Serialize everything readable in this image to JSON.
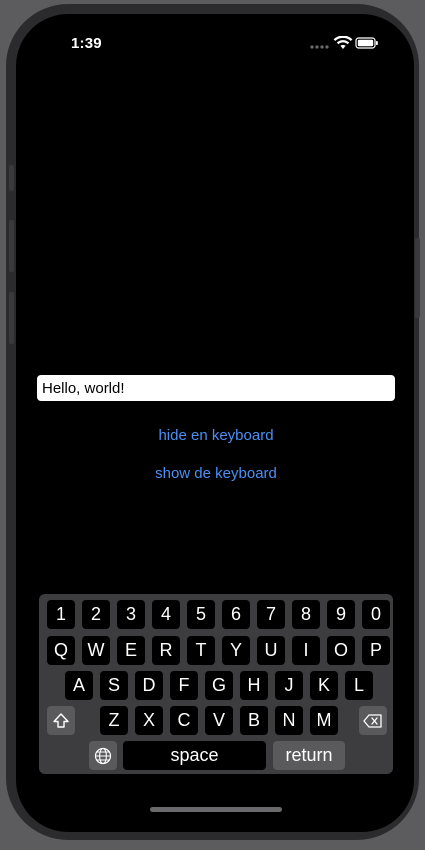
{
  "status": {
    "time": "1:39"
  },
  "field": {
    "value": "Hello, world!"
  },
  "buttons": {
    "hide": "hide en keyboard",
    "show": "show de keyboard"
  },
  "keyboard": {
    "row_digits": [
      "1",
      "2",
      "3",
      "4",
      "5",
      "6",
      "7",
      "8",
      "9",
      "0"
    ],
    "row1": [
      "Q",
      "W",
      "E",
      "R",
      "T",
      "Y",
      "U",
      "I",
      "O",
      "P"
    ],
    "row2": [
      "A",
      "S",
      "D",
      "F",
      "G",
      "H",
      "J",
      "K",
      "L"
    ],
    "row3": [
      "Z",
      "X",
      "C",
      "V",
      "B",
      "N",
      "M"
    ],
    "space": "space",
    "return": "return"
  },
  "colors": {
    "accent": "#4a90f7",
    "key_bg": "#000000",
    "keyboard_bg": "#3d3d3f"
  }
}
